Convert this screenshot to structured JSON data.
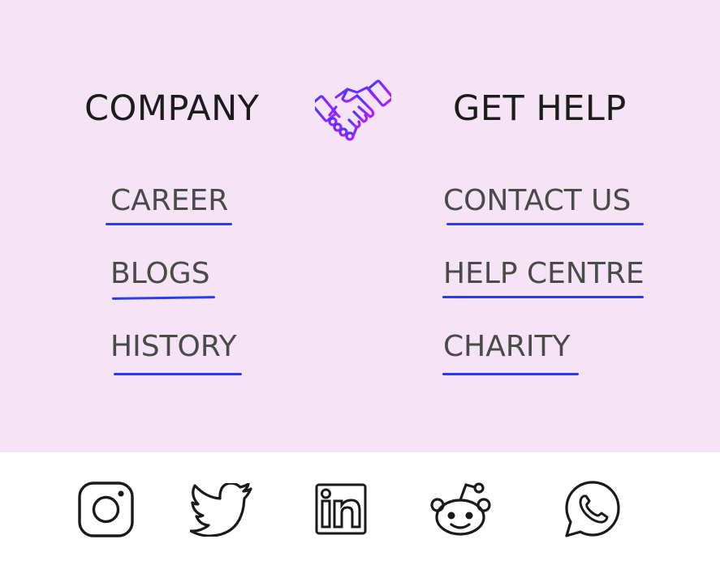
{
  "company": {
    "heading": "COMPANY",
    "links": [
      "CAREER",
      "BLOGS",
      "HISTORY"
    ]
  },
  "help": {
    "heading": "GET HELP",
    "links": [
      "CONTACT US",
      "HELP CENTRE",
      "CHARITY"
    ]
  },
  "logo_icon": "handshake-icon",
  "social": [
    "instagram-icon",
    "twitter-icon",
    "linkedin-icon",
    "reddit-icon",
    "whatsapp-icon"
  ],
  "colors": {
    "background": "#f4e4f6",
    "underline": "#2a3cf0",
    "logo_gradient_start": "#3b3cff",
    "logo_gradient_end": "#b21dff",
    "text": "#4a4a4a"
  }
}
